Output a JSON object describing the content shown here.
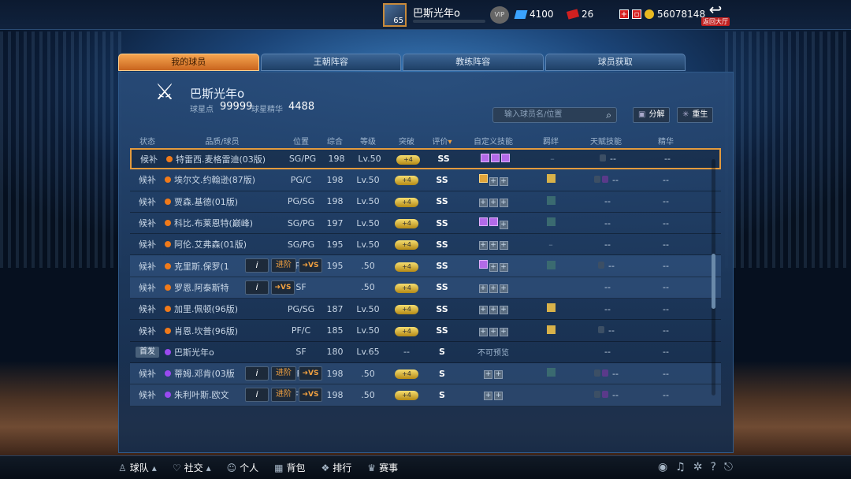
{
  "topbar": {
    "avatar_level": "65",
    "player_name": "巴斯光年o",
    "vip_label": "VIP",
    "gems": "4100",
    "tickets": "26",
    "coins": "56078148",
    "back_label": "返回大厅"
  },
  "tabs": [
    {
      "label": "我的球员"
    },
    {
      "label": "王朝阵容"
    },
    {
      "label": "教练阵容"
    },
    {
      "label": "球员获取"
    }
  ],
  "panel": {
    "team_name": "巴斯光年o",
    "stat1_label": "球星点",
    "stat1_value": "99999",
    "stat2_label": "球星精华",
    "stat2_value": "4488",
    "search_placeholder": "输入球员名/位置",
    "btn_decompose": "分解",
    "btn_rebirth": "重生"
  },
  "columns": [
    "状态",
    "品质/球员",
    "位置",
    "综合",
    "等级",
    "突破",
    "评价",
    "自定义技能",
    "羁绊",
    "天赋技能",
    "精华"
  ],
  "rows": [
    {
      "status": "候补",
      "name": "特雷西.麦格雷迪(03版)",
      "pos": "SG/PG",
      "ovr": "198",
      "lvl": "Lv.50",
      "brk": "+4",
      "eval": "SS",
      "talent": "--",
      "ess": "--"
    },
    {
      "status": "候补",
      "name": "埃尔文.约翰逊(87版)",
      "pos": "PG/C",
      "ovr": "198",
      "lvl": "Lv.50",
      "brk": "+4",
      "eval": "SS",
      "talent": "--",
      "ess": "--"
    },
    {
      "status": "候补",
      "name": "贾森.基德(01版)",
      "pos": "PG/SG",
      "ovr": "198",
      "lvl": "Lv.50",
      "brk": "+4",
      "eval": "SS",
      "talent": "--",
      "ess": "--"
    },
    {
      "status": "候补",
      "name": "科比.布莱恩特(巅峰)",
      "pos": "SG/PG",
      "ovr": "197",
      "lvl": "Lv.50",
      "brk": "+4",
      "eval": "SS",
      "talent": "--",
      "ess": "--"
    },
    {
      "status": "候补",
      "name": "阿伦.艾弗森(01版)",
      "pos": "SG/PG",
      "ovr": "195",
      "lvl": "Lv.50",
      "brk": "+4",
      "eval": "SS",
      "talent": "--",
      "ess": "--"
    },
    {
      "status": "候补",
      "name": "克里斯.保罗(1",
      "pos": "PG",
      "ovr": "195",
      "lvl": ".50",
      "brk": "+4",
      "eval": "SS",
      "talent": "--",
      "ess": "--"
    },
    {
      "status": "候补",
      "name": "罗恩.阿泰斯特",
      "pos": "SF",
      "ovr": "",
      "lvl": ".50",
      "brk": "+4",
      "eval": "SS",
      "talent": "--",
      "ess": "--"
    },
    {
      "status": "候补",
      "name": "加里.佩顿(96版)",
      "pos": "PG/SG",
      "ovr": "187",
      "lvl": "Lv.50",
      "brk": "+4",
      "eval": "SS",
      "talent": "--",
      "ess": "--"
    },
    {
      "status": "候补",
      "name": "肖恩.坎普(96版)",
      "pos": "PF/C",
      "ovr": "185",
      "lvl": "Lv.50",
      "brk": "+4",
      "eval": "SS",
      "talent": "--",
      "ess": "--"
    },
    {
      "status": "首发",
      "name": "巴斯光年o",
      "pos": "SF",
      "ovr": "180",
      "lvl": "Lv.65",
      "brk": "--",
      "eval": "S",
      "skills": "不可预览",
      "talent": "--",
      "ess": "--"
    },
    {
      "status": "候补",
      "name": "蒂姆.邓肯(03版",
      "pos": "PF/C",
      "ovr": "198",
      "lvl": ".50",
      "brk": "+4",
      "eval": "S",
      "talent": "--",
      "ess": "--"
    },
    {
      "status": "候补",
      "name": "朱利叶斯.欧文",
      "pos": "SF/SG",
      "ovr": "198",
      "lvl": ".50",
      "brk": "+4",
      "eval": "S",
      "talent": "--",
      "ess": "--"
    }
  ],
  "overlay": {
    "info": "i",
    "advance": "进阶",
    "vs": "VS"
  },
  "bottom": [
    {
      "label": "球队"
    },
    {
      "label": "社交"
    },
    {
      "label": "个人"
    },
    {
      "label": "背包"
    },
    {
      "label": "排行"
    },
    {
      "label": "赛事"
    }
  ],
  "colors": {
    "accent": "#f6a550",
    "highlight": "#e39a3d",
    "quality_orange": "#f07a1a",
    "quality_purple": "#9a4af0"
  }
}
